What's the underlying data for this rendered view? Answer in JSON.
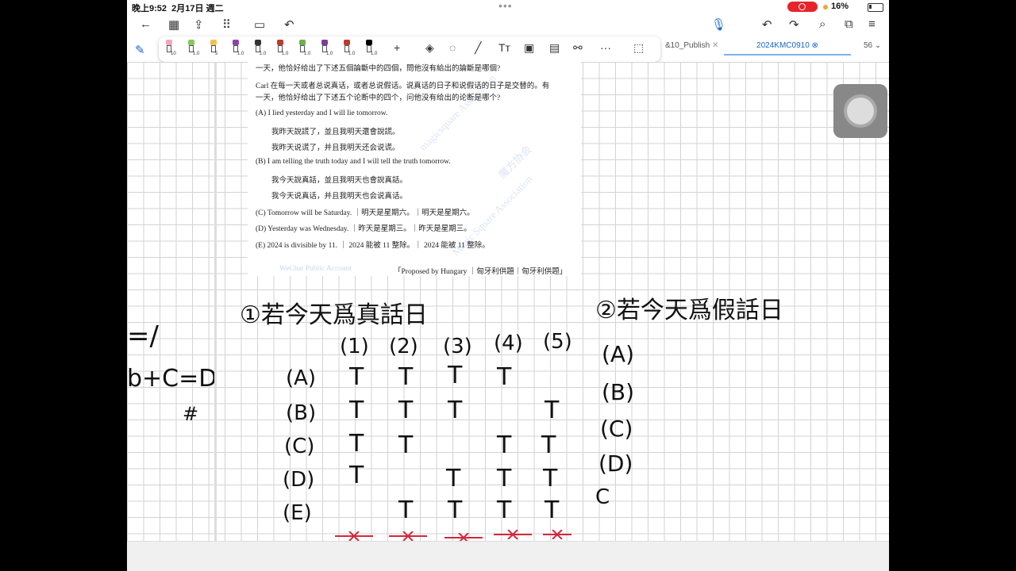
{
  "status_bar": {
    "time": "晚上9:52",
    "date": "2月17日 週二",
    "battery": "16%"
  },
  "tabs": {
    "tab1": "&10_Publish",
    "tab2": "2024KMC0910",
    "page_count": "56"
  },
  "pens": [
    {
      "color": "#f3a6c0",
      "size": "10"
    },
    {
      "color": "#86c85a",
      "size": "1.0"
    },
    {
      "color": "#f2c14e",
      "size": "5"
    },
    {
      "color": "#8e44ad",
      "size": "1.0"
    },
    {
      "color": "#333333",
      "size": "1.0"
    },
    {
      "color": "#c0392b",
      "size": "1.0"
    },
    {
      "color": "#6ab04c",
      "size": "1.0"
    },
    {
      "color": "#7d3c98",
      "size": "1.0"
    },
    {
      "color": "#c0392b",
      "size": "1.0"
    },
    {
      "color": "#000000",
      "size": "1.0"
    }
  ],
  "pdf": {
    "line1": "一天，他恰好给出了下述五個論斷中的四個，問他沒有給出的論斷是哪個?",
    "line2": "Carl 在每一天或者总说真话，或者总说假话。说真话的日子和说假话的日子是交替的。有",
    "line3": "一天，他恰好给出了下述五个论断中的四个，问他没有给出的论断是哪个?",
    "optA": "(A)  I lied yesterday and I will lie tomorrow.",
    "optA_tc": "我昨天說謊了，並且我明天還會說謊。",
    "optA_sc": "我昨天说谎了，并且我明天还会说谎。",
    "optB": "(B)  I am telling the truth today and I will tell the truth tomorrow.",
    "optB_tc": "我今天說真話，並且我明天也會說真話。",
    "optB_sc": "我今天说真话，并且我明天也会说真话。",
    "optC": "(C)  Tomorrow will be Saturday. ｜明天是星期六。｜明天是星期六。",
    "optD": "(D)  Yesterday was Wednesday. ｜昨天是星期三。｜昨天是星期三。",
    "optE": "(E)  2024 is divisible by 11. ｜ 2024 能被 11 整除。｜ 2024 能被 11 整除。",
    "credit": "「Proposed by Hungary ｜匈牙利供題｜匈牙利供题」",
    "footer": "WeChat Public Account",
    "wm1": "magicsquare Association",
    "wm2": "魔方协会",
    "wm3": "Magic Square Association"
  },
  "handwriting": {
    "left_eq1": "=/",
    "left_eq2": "b+C=D",
    "left_hash": "#",
    "title1": "①若今天爲真話日",
    "title2": "②若今天爲假話日",
    "cols": [
      "(1)",
      "(2)",
      "(3)",
      "(4)",
      "(5)"
    ],
    "rows": [
      "(A)",
      "(B)",
      "(C)",
      "(D)",
      "(E)"
    ],
    "grid": [
      [
        "T",
        "T",
        "T",
        "T",
        ""
      ],
      [
        "T",
        "T",
        "T",
        "",
        "T"
      ],
      [
        "T",
        "T",
        "",
        "T",
        "T"
      ],
      [
        "T",
        "",
        "T",
        "T",
        "T"
      ],
      [
        "",
        "T",
        "T",
        "T",
        "T"
      ]
    ],
    "rows2": [
      "(A)",
      "(B)",
      "(C)",
      "(D)",
      "C"
    ]
  }
}
